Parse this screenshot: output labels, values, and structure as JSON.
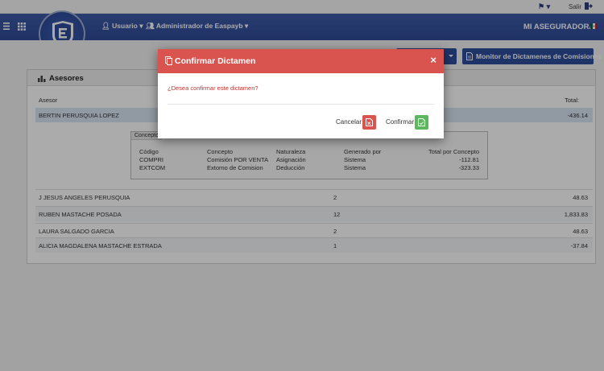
{
  "topbar": {
    "salir_label": "Salir"
  },
  "header": {
    "usuario_label": "Usuario",
    "admin_label": "Administrador de Easpayb",
    "company": "MI ASEGURADORA"
  },
  "toolbar": {
    "monitor_label": "Monitor de Dictamenes de Comisiones"
  },
  "panel": {
    "title": "Asesores",
    "col_asesor": "Asesor",
    "col_total": "Total:",
    "selected": {
      "name": "BERTIN PERUSQUIA LOPEZ",
      "total": "-436.14"
    },
    "detail": {
      "tab_label": "Concepto",
      "headers": [
        "Código",
        "Concepto",
        "Naturaleza",
        "Generado por",
        "Total por Concepto"
      ],
      "rows": [
        [
          "COMPRI",
          "Comisión POR VENTA",
          "Asignación",
          "Sistema",
          "-112.81"
        ],
        [
          "EXTCOM",
          "Extorno de Comision",
          "Deducción",
          "Sistema",
          "-323.33"
        ]
      ]
    },
    "rows": [
      {
        "name": "J JESUS ANGELES PERUSQUIA",
        "count": "2",
        "total": "48.63"
      },
      {
        "name": "RUBEN MASTACHE POSADA",
        "count": "12",
        "total": "1,833.83"
      },
      {
        "name": "LAURA SALGADO GARCIA",
        "count": "2",
        "total": "48.63"
      },
      {
        "name": "ALICIA MAGDALENA MASTACHE ESTRADA",
        "count": "1",
        "total": "-37.84"
      }
    ]
  },
  "modal": {
    "title": "Confirmar Dictamen",
    "close_glyph": "×",
    "message": "¿Desea confirmar este dictamen?",
    "cancel_label": "Cancelar",
    "confirm_label": "Confirmar"
  },
  "colors": {
    "header_blue": "#2f4a97",
    "modal_red": "#d9534f",
    "confirm_green": "#5cb85c",
    "highlight_row": "#d9e5f3"
  }
}
